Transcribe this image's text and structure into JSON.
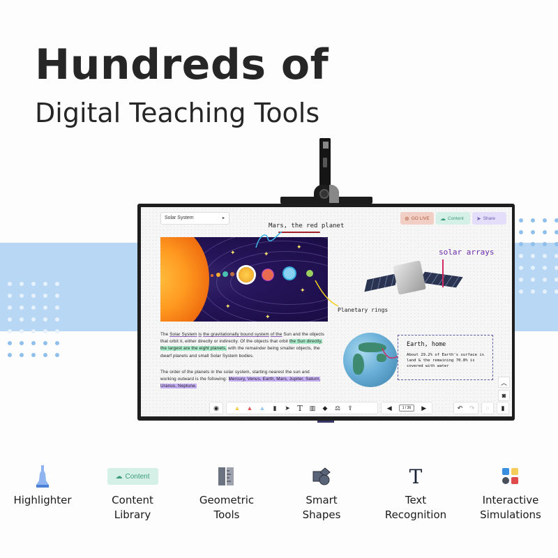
{
  "headline": {
    "line1": "Hundreds of",
    "line2": "Digital Teaching Tools"
  },
  "app": {
    "dropdown": {
      "value": "Solar System"
    },
    "buttons": {
      "go_live": "GO LIVE",
      "content": "Content",
      "share": "Share"
    },
    "annotations": {
      "mars": "Mars, the red planet",
      "solar_arrays": "solar arrays",
      "rings": "Planetary rings",
      "earth_title": "Earth, home",
      "earth_body": "About 29.2% of Earth's surface is land & the remaining 70.8% is covered with water"
    },
    "paragraph1": {
      "p1": "The ",
      "u1": "Solar System",
      "p2": " ",
      "u2": "is",
      "p3": " ",
      "u3": "the gravitationally bound system",
      "p4": " ",
      "u4": "of the",
      "p5": " Sun and the objects that orbit it, either directly or indirectly. Of the objects that orbit ",
      "hl": "the Sun directly, the largest are the eight planets,",
      "p6": " with the remainder being smaller objects, the dwarf planets and small Solar System bodies."
    },
    "paragraph2": {
      "p1": "The order of the planets in the solar system, starting nearest the sun and working outward is the following: ",
      "hl": "Mercury, Venus, Earth, Mars, Jupiter, Saturn, Uranus, Neptune."
    },
    "pager": {
      "value": "1 / 36"
    },
    "icons": {
      "record": "record-icon",
      "highlighter_yellow": "highlighter-icon",
      "highlighter_red": "highlighter-icon",
      "highlighter_blue": "highlighter-icon",
      "eraser": "eraser-icon",
      "pointer": "cursor-icon",
      "text": "text-icon",
      "ruler": "ruler-icon",
      "shapes": "shapes-icon",
      "simulation": "simulation-icon",
      "export": "export-icon"
    }
  },
  "features": [
    {
      "label1": "Highlighter",
      "label2": ""
    },
    {
      "label1": "Content",
      "label2": "Library",
      "badge": "Content"
    },
    {
      "label1": "Geometric",
      "label2": "Tools"
    },
    {
      "label1": "Smart",
      "label2": "Shapes"
    },
    {
      "label1": "Text",
      "label2": "Recognition"
    },
    {
      "label1": "Interactive",
      "label2": "Simulations"
    }
  ],
  "colors": {
    "band": "#b8d7f4",
    "dot_blue": "#8fc0ec",
    "accent_green": "#a9ecc9",
    "accent_purple": "#c7b0f6"
  }
}
